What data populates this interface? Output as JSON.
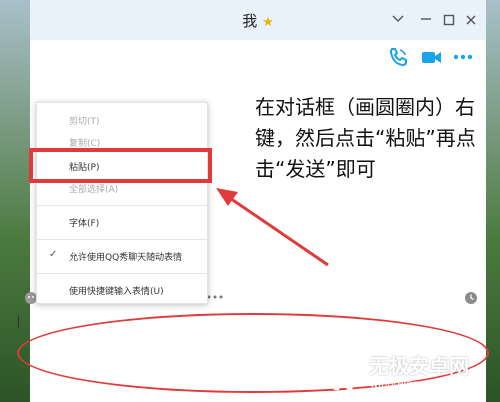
{
  "window": {
    "title": "我",
    "title_star": "★"
  },
  "annotation": {
    "text": "在对话框（画圆圈内）右键，然后点击“粘贴”再点击“发送”即可"
  },
  "context_menu": {
    "items": [
      {
        "label": "剪切(T)",
        "disabled": true
      },
      {
        "label": "复制(C)",
        "disabled": true
      },
      {
        "label": "粘贴(P)",
        "disabled": false
      },
      {
        "label": "全部选择(A)",
        "disabled": true
      },
      {
        "label": "字体(F)",
        "disabled": false
      },
      {
        "label": "允许使用QQ秀聊天随动表情",
        "disabled": false,
        "checked": true
      },
      {
        "label": "使用快捷键输入表情(U)",
        "disabled": false
      }
    ]
  },
  "watermark": {
    "name": "无极安卓网",
    "url": "wjhotelgroup.com"
  },
  "colors": {
    "accent": "#1aa3e8",
    "highlight_red": "#e03a3a",
    "titlebar": "#e9f1fb"
  },
  "icons": {
    "phone": "phone-icon",
    "video": "video-icon",
    "more": "more-icon",
    "minimize": "minimize-icon",
    "maximize": "maximize-icon",
    "close": "close-icon",
    "dropdown": "chevron-down-icon",
    "emoji": "emoji-icon",
    "history": "clock-icon"
  }
}
